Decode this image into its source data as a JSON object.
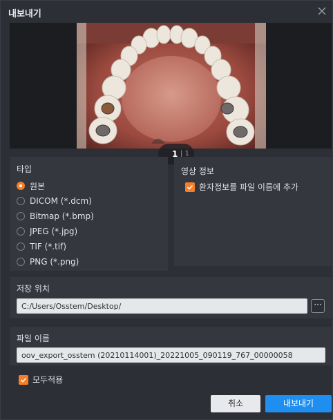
{
  "dialog": {
    "title": "내보내기"
  },
  "preview": {
    "page_current": "1",
    "page_separator": "| 1"
  },
  "type_panel": {
    "label": "타입",
    "options": [
      {
        "label": "원본",
        "selected": true
      },
      {
        "label": "DICOM (*.dcm)",
        "selected": false
      },
      {
        "label": "Bitmap (*.bmp)",
        "selected": false
      },
      {
        "label": "JPEG (*.jpg)",
        "selected": false
      },
      {
        "label": "TIF (*.tif)",
        "selected": false
      },
      {
        "label": "PNG (*.png)",
        "selected": false
      }
    ]
  },
  "image_info_panel": {
    "label": "영상 정보",
    "checkbox_label": "환자정보를 파일 이름에 추가",
    "checked": true
  },
  "save_location": {
    "label": "저장 위치",
    "path": "C:/Users/Osstem/Desktop/",
    "browse_label": "···"
  },
  "file_name": {
    "label": "파일 이름",
    "value": "oov_export_osstem (20210114001)_20221005_090119_767_00000058"
  },
  "apply_all": {
    "label": "모두적용",
    "checked": true
  },
  "buttons": {
    "cancel": "취소",
    "export": "내보내기"
  },
  "colors": {
    "accent_orange": "#f47e29",
    "primary_blue": "#1f8ef1",
    "dialog_bg": "#2c2f35",
    "panel_bg": "#34373d"
  },
  "icons": {
    "close": "close-icon",
    "check": "check-icon"
  }
}
